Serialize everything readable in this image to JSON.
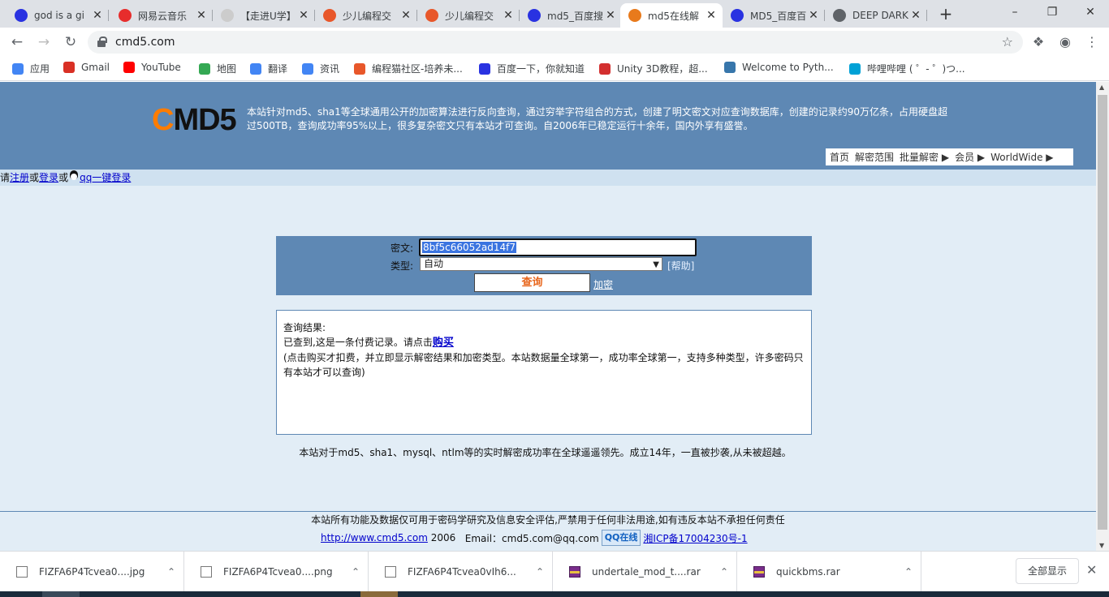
{
  "browser": {
    "tabs": [
      {
        "title": "god is a gi",
        "favicon": "baidu-paw-icon",
        "color": "#2932e1"
      },
      {
        "title": "网易云音乐",
        "favicon": "netease-music-icon",
        "color": "#e72d2c"
      },
      {
        "title": "【走进U学】",
        "favicon": "page-icon",
        "color": "#cccccc"
      },
      {
        "title": "少儿编程交",
        "favicon": "codemao-icon",
        "color": "#e8572a"
      },
      {
        "title": "少儿编程交",
        "favicon": "codemao-icon",
        "color": "#e8572a"
      },
      {
        "title": "md5_百度搜",
        "favicon": "baidu-paw-icon",
        "color": "#2932e1"
      },
      {
        "title": "md5在线解",
        "favicon": "cmd5-icon",
        "color": "#e87a1c",
        "active": true
      },
      {
        "title": "MD5_百度百",
        "favicon": "baidu-paw-icon",
        "color": "#2932e1"
      },
      {
        "title": "DEEP DARK",
        "favicon": "globe-icon",
        "color": "#5f6368"
      }
    ],
    "url": "cmd5.com",
    "bookmarks": [
      {
        "label": "应用",
        "icon": "apps-grid-icon",
        "color": "#4285f4"
      },
      {
        "label": "Gmail",
        "icon": "gmail-icon",
        "color": "#d93025"
      },
      {
        "label": "YouTube",
        "icon": "youtube-icon",
        "color": "#ff0000"
      },
      {
        "label": "地图",
        "icon": "maps-icon",
        "color": "#34a853"
      },
      {
        "label": "翻译",
        "icon": "translate-icon",
        "color": "#4285f4"
      },
      {
        "label": "资讯",
        "icon": "news-icon",
        "color": "#4285f4"
      },
      {
        "label": "编程猫社区-培养未...",
        "icon": "codemao-icon",
        "color": "#e8572a"
      },
      {
        "label": "百度一下，你就知道",
        "icon": "baidu-paw-icon",
        "color": "#2932e1"
      },
      {
        "label": "Unity 3D教程，超...",
        "icon": "unity-c-icon",
        "color": "#d32f2f"
      },
      {
        "label": "Welcome to Pyth...",
        "icon": "python-icon",
        "color": "#3776ab"
      },
      {
        "label": "哔哩哔哩 ( ゜- ゜)つ...",
        "icon": "bilibili-icon",
        "color": "#00a1d6"
      }
    ]
  },
  "site": {
    "logo_c": "C",
    "logo_rest": "MD5",
    "intro": "本站针对md5、sha1等全球通用公开的加密算法进行反向查询，通过穷举字符组合的方式，创建了明文密文对应查询数据库，创建的记录约90万亿条，占用硬盘超过500TB，查询成功率95%以上，很多复杂密文只有本站才可查询。自2006年已稳定运行十余年，国内外享有盛誉。",
    "menu": [
      "首页",
      "解密范围",
      "批量解密 ▶",
      "会员 ▶",
      "WorldWide ▶"
    ],
    "login": {
      "pre": "请",
      "register": "注册",
      "or1": "或",
      "login": "登录",
      "or2": "或",
      "qq": "qq一键登录"
    },
    "form": {
      "cipher_label": "密文:",
      "cipher_value": "8bf5c66052ad14f7",
      "type_label": "类型:",
      "type_value": "自动",
      "help": "[帮助]",
      "query_button": "查询",
      "encrypt_link": "加密"
    },
    "result": {
      "heading": "查询结果:",
      "line1": "已查到,这是一条付费记录。请点击",
      "buy": "购买",
      "line2": "(点击购买才扣费，并立即显示解密结果和加密类型。本站数据量全球第一，成功率全球第一，支持多种类型，许多密码只有本站才可以查询)"
    },
    "note": "本站对于md5、sha1、mysql、ntlm等的实时解密成功率在全球遥遥领先。成立14年，一直被抄袭,从未被超越。",
    "footer": {
      "disclaimer": "本站所有功能及数据仅可用于密码学研究及信息安全评估,严禁用于任何非法用途,如有违反本站不承担任何责任",
      "link": "http://www.cmd5.com",
      "year": "2006",
      "email": "Email：cmd5.com@qq.com",
      "qq_online": "QQ在线",
      "icp": "湘ICP备17004230号-1"
    }
  },
  "downloads": {
    "items": [
      {
        "name": "FIZFA6P4Tcvea0....jpg",
        "icon": "image-file-icon"
      },
      {
        "name": "FIZFA6P4Tcvea0....png",
        "icon": "image-file-icon"
      },
      {
        "name": "FIZFA6P4Tcvea0vIh6...",
        "icon": "file-icon"
      },
      {
        "name": "undertale_mod_t....rar",
        "icon": "rar-archive-icon"
      },
      {
        "name": "quickbms.rar",
        "icon": "rar-archive-icon"
      }
    ],
    "show_all": "全部显示"
  }
}
